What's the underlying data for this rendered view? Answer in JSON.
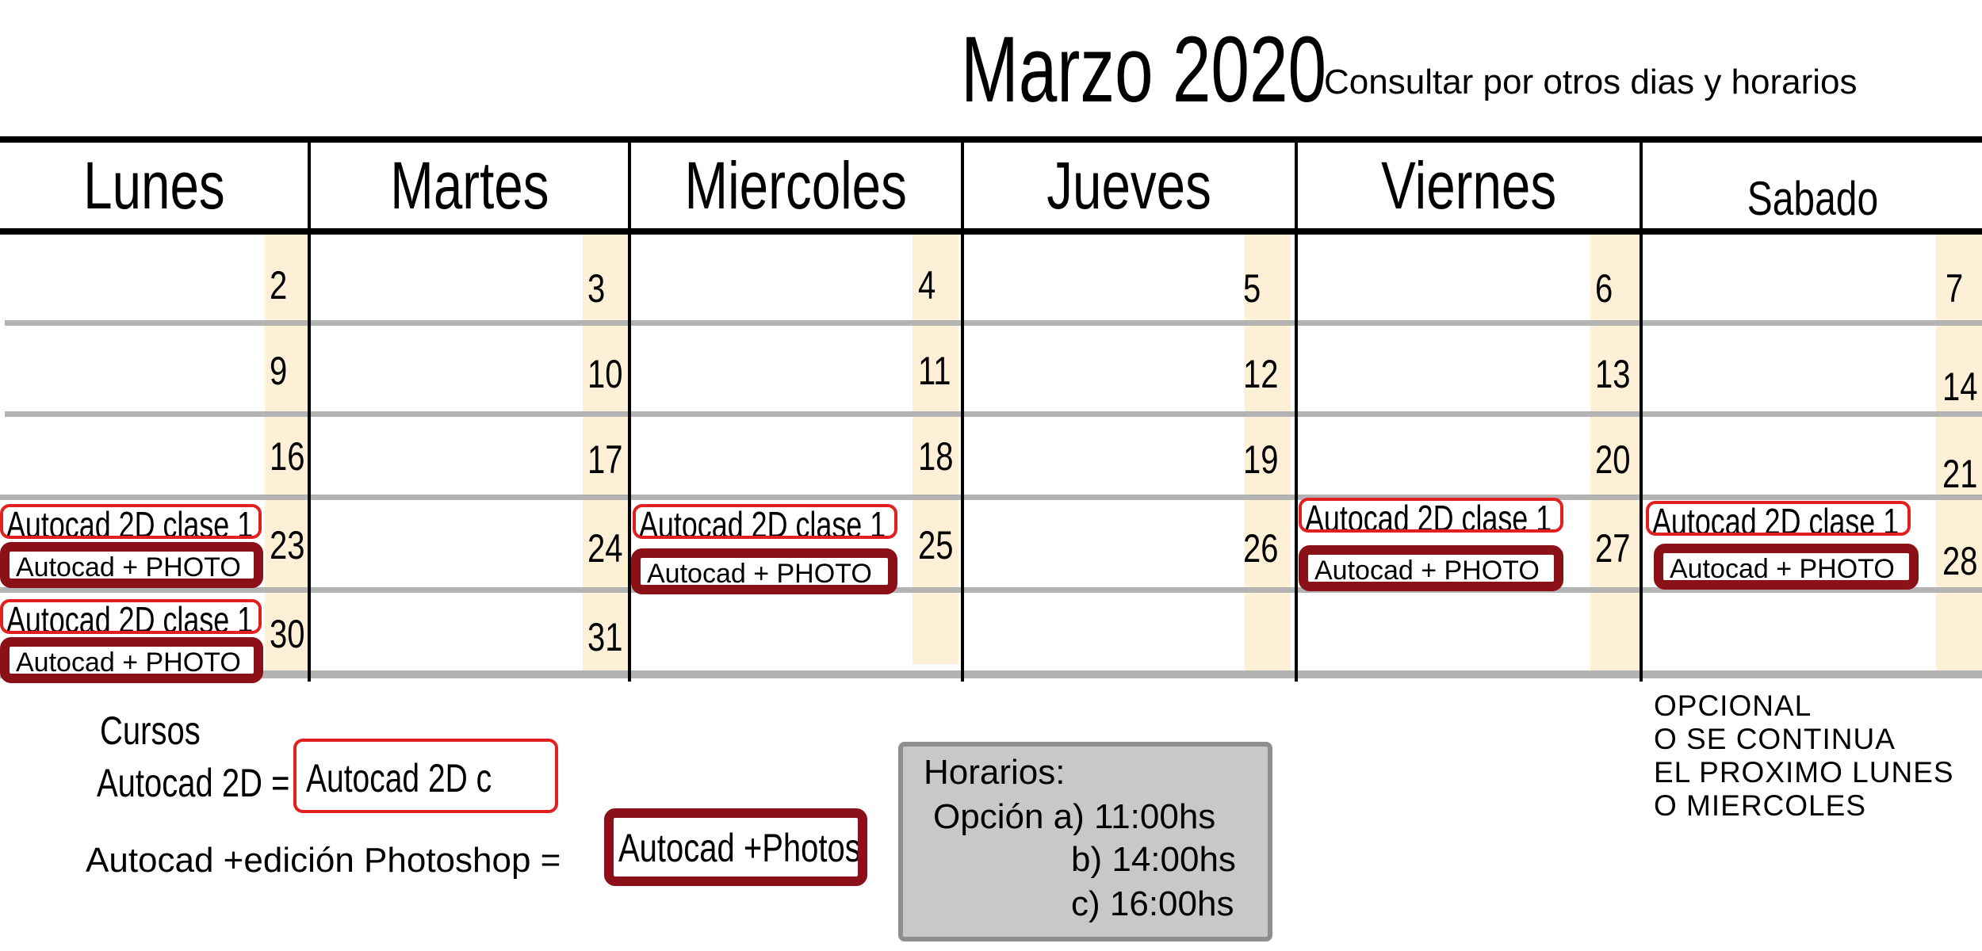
{
  "header": {
    "title": "Marzo 2020",
    "subtitle": "Consultar por otros dias y horarios"
  },
  "weekdays": [
    "Lunes",
    "Martes",
    "Miercoles",
    "Jueves",
    "Viernes",
    "Sabado"
  ],
  "weeks": [
    [
      "2",
      "3",
      "4",
      "5",
      "6",
      "7"
    ],
    [
      "9",
      "10",
      "11",
      "12",
      "13",
      "14"
    ],
    [
      "16",
      "17",
      "18",
      "19",
      "20",
      "21"
    ],
    [
      "23",
      "24",
      "25",
      "26",
      "27",
      "28"
    ],
    [
      "30",
      "31"
    ]
  ],
  "events": {
    "autocad_2d": "Autocad 2D clase 1",
    "autocad_photo": "Autocad  + PHOTO"
  },
  "legend": {
    "heading": "Cursos",
    "autocad_2d_label": "Autocad 2D =",
    "autocad_2d_sample": "Autocad 2D c",
    "photoshop_label": "Autocad +edición Photoshop =",
    "photoshop_sample": "Autocad +Photosh"
  },
  "horarios": {
    "title": "Horarios:",
    "option_a": "Opción  a)  11:00hs",
    "option_b": "b)  14:00hs",
    "option_c": "c)  16:00hs"
  },
  "note": [
    "OPCIONAL",
    "O SE CONTINUA",
    "EL PROXIMO LUNES",
    "O MIERCOLES"
  ],
  "colors": {
    "day_number_column": "#fdf0d6",
    "chip_red_border": "#e32020",
    "chip_dark_border": "#8b1018",
    "grid_grey": "#b3b3b3",
    "horarios_bg": "#c8c8c8"
  }
}
